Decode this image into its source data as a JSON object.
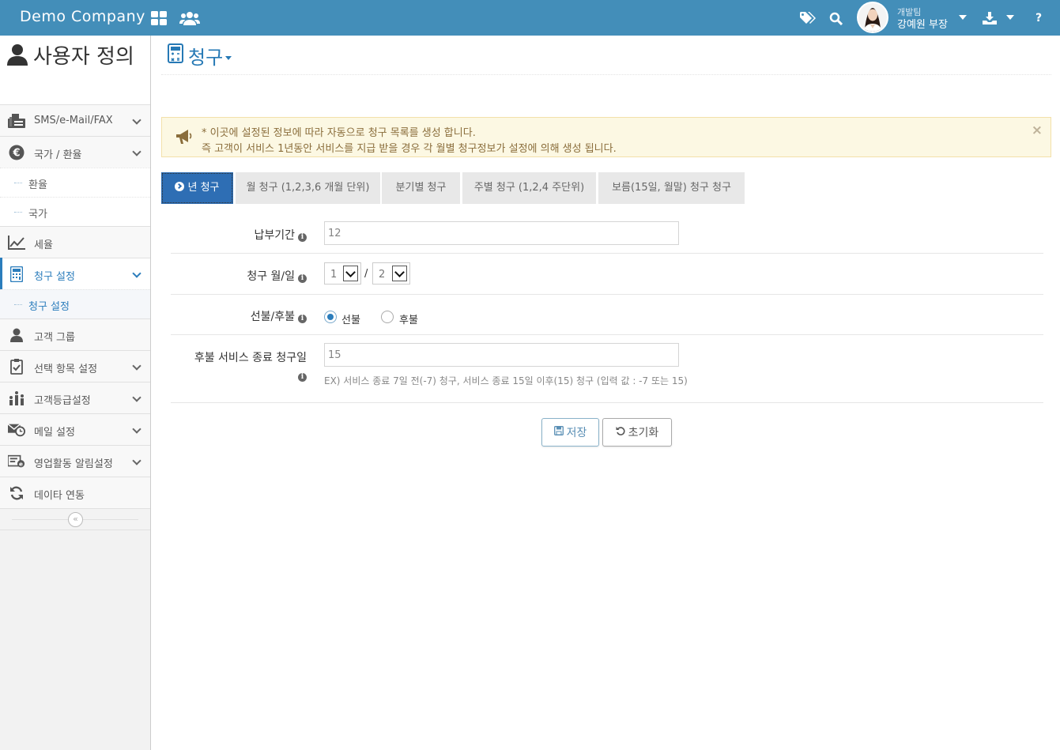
{
  "app": {
    "brand": "Demo Company"
  },
  "user": {
    "team": "개발팀",
    "name": "강예원 부장"
  },
  "sidebar": {
    "title": "사용자 정의",
    "items": [
      {
        "label": "SMS/e-Mail/FAX"
      },
      {
        "label": "국가 / 환율"
      },
      {
        "label": "환율"
      },
      {
        "label": "국가"
      },
      {
        "label": "세율"
      },
      {
        "label": "청구 설정"
      },
      {
        "label": "청구 설정"
      },
      {
        "label": "고객 그룹"
      },
      {
        "label": "선택 항목 설정"
      },
      {
        "label": "고객등급설정"
      },
      {
        "label": "메일 설정"
      },
      {
        "label": "영업활동 알림설정"
      },
      {
        "label": "데이타 연동"
      }
    ]
  },
  "page": {
    "title": "청구"
  },
  "alert": {
    "line1": "* 이곳에 설정된 정보에 따라 자동으로 청구 목록를 생성 합니다.",
    "line2": "즉 고객이 서비스 1년동안 서비스를 지급 받을 경우 각 월별 청구정보가 설정에 의해 생성 됩니다.",
    "close": "×"
  },
  "tabs": [
    {
      "label": "년 청구",
      "active": true
    },
    {
      "label": "월 청구 (1,2,3,6 개월 단위)"
    },
    {
      "label": "분기별 청구"
    },
    {
      "label": "주별 청구 (1,2,4 주단위)"
    },
    {
      "label": "보름(15일, 월말) 청구 청구"
    }
  ],
  "form": {
    "payment_period": {
      "label": "납부기간",
      "value": "12"
    },
    "billing_date": {
      "label": "청구 월/일",
      "month": "1",
      "separator": "/",
      "day": "2"
    },
    "prepay": {
      "label": "선불/후불",
      "option1": "선불",
      "option2": "후불",
      "selected": "선불"
    },
    "postpay_end": {
      "label": "후불 서비스 종료 청구일",
      "value": "15",
      "help": "EX) 서비스 종료 7일 전(-7) 청구, 서비스 종료 15일 이후(15) 청구 (입력 값 : -7 또는 15)"
    }
  },
  "buttons": {
    "save": "저장",
    "reset": "초기화"
  },
  "colors": {
    "navbar": "#438eb9",
    "active_tab": "#2e6eb4",
    "accent": "#2b7dbc",
    "alert_bg": "#fcf8e3"
  }
}
